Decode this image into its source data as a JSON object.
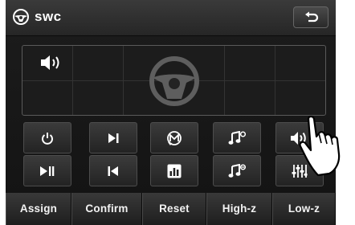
{
  "header": {
    "title": "swc",
    "app_icon": "steering-wheel-icon",
    "back_icon": "return-arrow-icon"
  },
  "panel": {
    "speaker_icon": "speaker-icon",
    "wheel_icon": "steering-wheel-icon"
  },
  "controls": [
    {
      "name": "power-button",
      "icon": "power-icon"
    },
    {
      "name": "next-track-button",
      "icon": "skip-next-icon"
    },
    {
      "name": "mode-button",
      "icon": "mode-m-icon"
    },
    {
      "name": "music-next-button",
      "icon": "music-note-icon"
    },
    {
      "name": "volume-up-button",
      "icon": "speaker-icon"
    },
    {
      "name": "play-pause-button",
      "icon": "play-pause-icon"
    },
    {
      "name": "previous-track-button",
      "icon": "skip-previous-icon"
    },
    {
      "name": "equalizer-button",
      "icon": "bar-chart-icon"
    },
    {
      "name": "music-previous-button",
      "icon": "music-note-icon"
    },
    {
      "name": "audio-settings-button",
      "icon": "sliders-icon"
    }
  ],
  "bottom_bar": {
    "assign": "Assign",
    "confirm": "Confirm",
    "reset": "Reset",
    "high_z": "High-z",
    "low_z": "Low-z"
  },
  "colors": {
    "text": "#ffffff",
    "button_top": "#3b3b3b",
    "button_bottom": "#232323"
  }
}
